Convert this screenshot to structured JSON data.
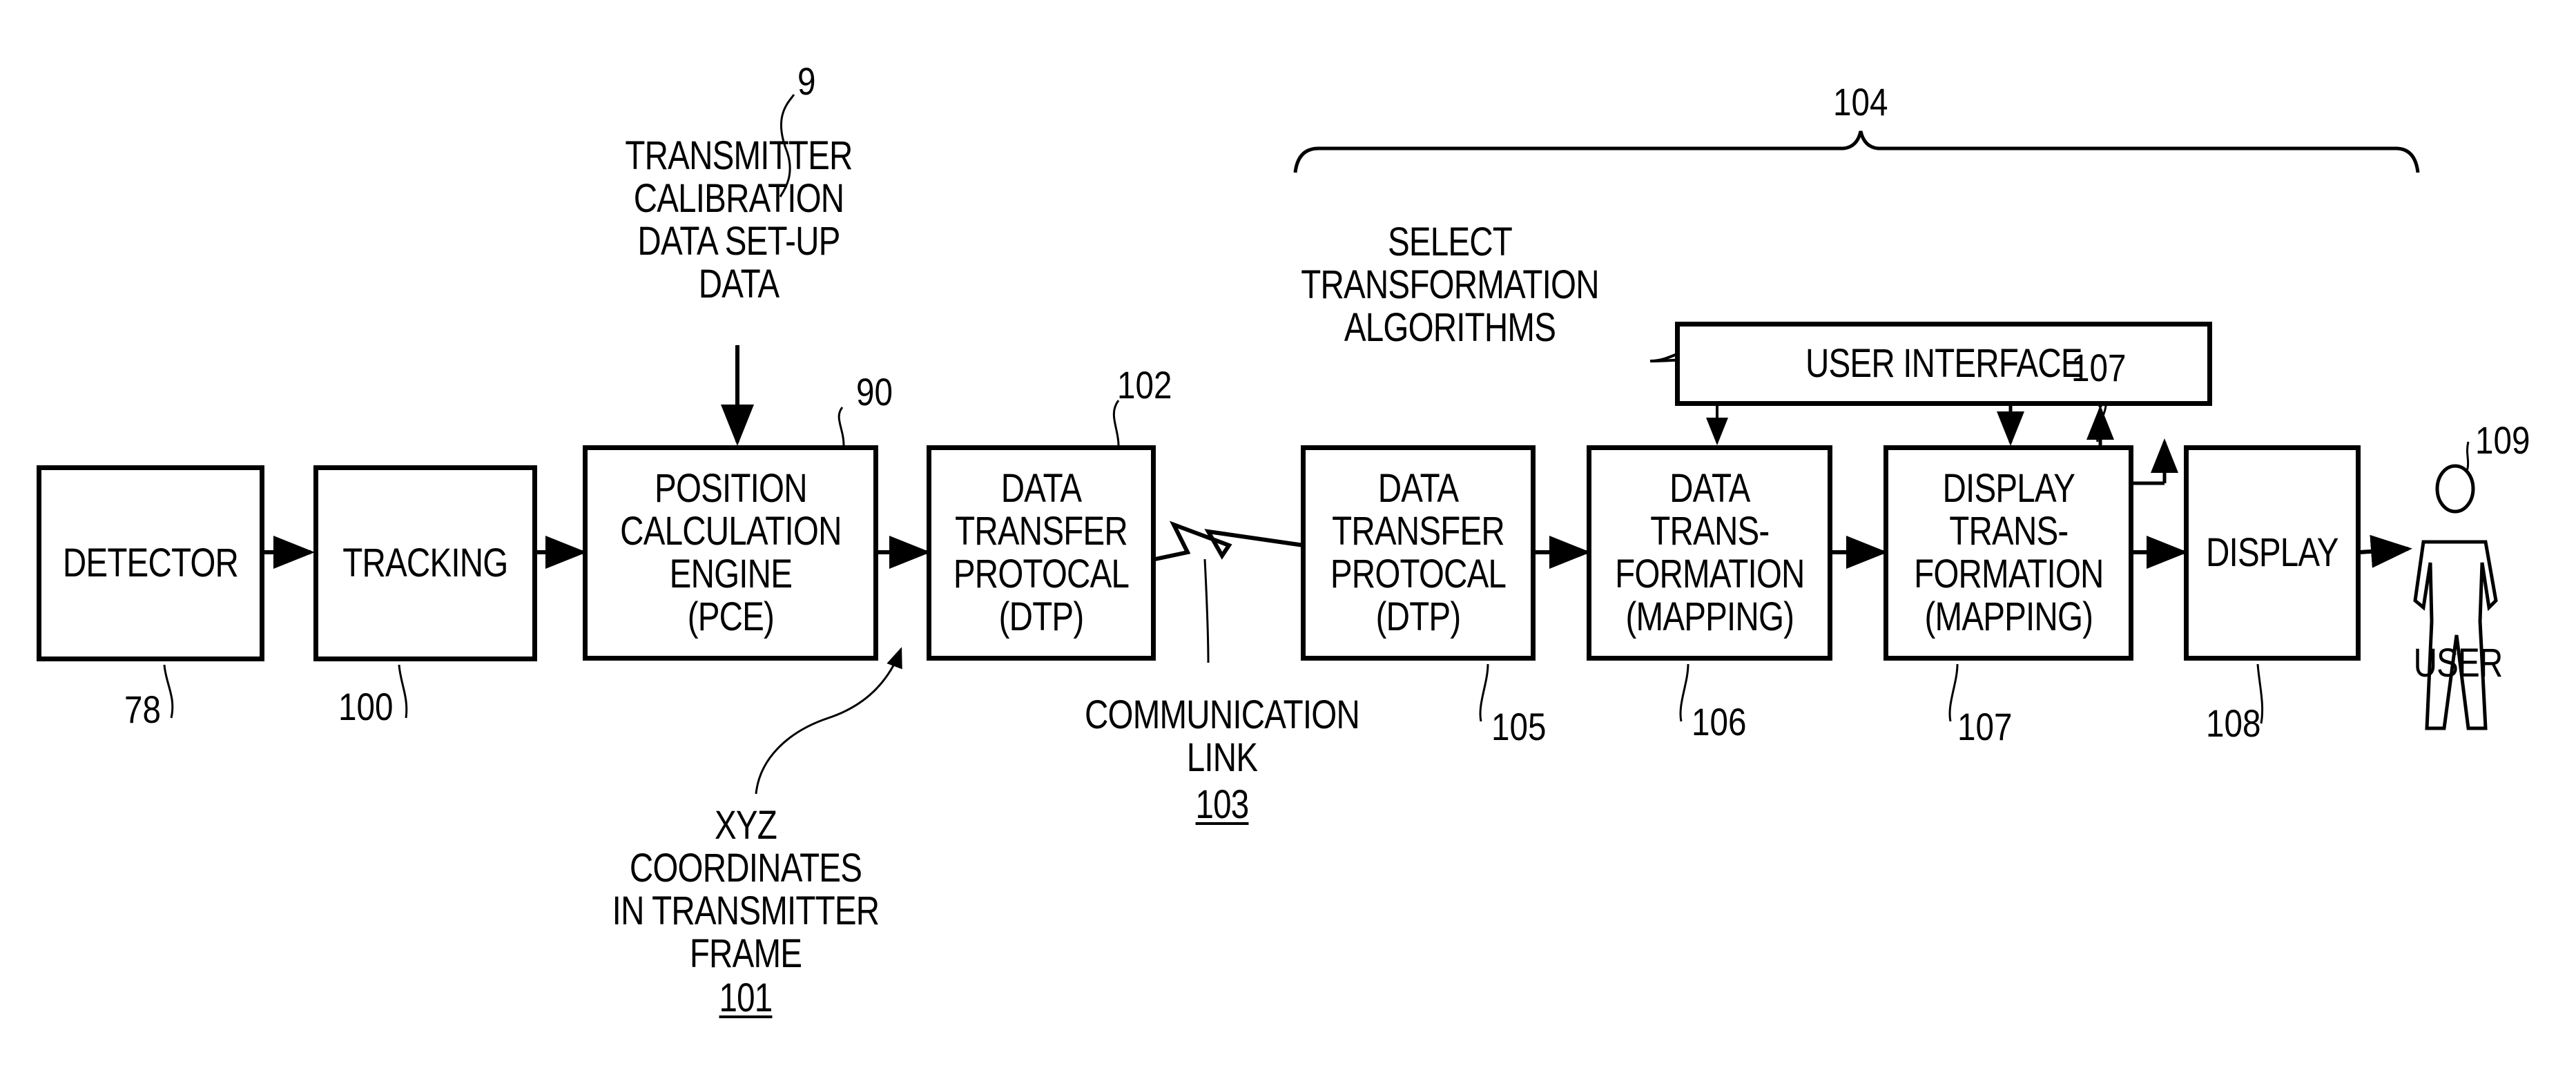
{
  "figure": {
    "blocks": [
      {
        "id": "detector",
        "label": "DETECTOR",
        "ref": "78"
      },
      {
        "id": "tracking",
        "label": "TRACKING",
        "ref": "100"
      },
      {
        "id": "pce",
        "label": "POSITION\nCALCULATION\nENGINE\n(PCE)",
        "ref": "90"
      },
      {
        "id": "dtp1",
        "label": "DATA\nTRANSFER\nPROTOCAL\n(DTP)",
        "ref": "102"
      },
      {
        "id": "dtp2",
        "label": "DATA\nTRANSFER\nPROTOCAL\n(DTP)",
        "ref": "105"
      },
      {
        "id": "data-transformation",
        "label": "DATA\nTRANS-\nFORMATION\n(MAPPING)",
        "ref": "106"
      },
      {
        "id": "display-transformation",
        "label": "DISPLAY\nTRANS-\nFORMATION\n(MAPPING)",
        "ref": "107"
      },
      {
        "id": "display",
        "label": "DISPLAY",
        "ref": "108"
      }
    ],
    "user_interface": {
      "label": "USER INTERFACE",
      "ref": "107"
    },
    "group_ref": "104",
    "user": {
      "label": "USER",
      "ref": "109"
    },
    "annotations": {
      "calibration": {
        "text": "TRANSMITTER\nCALIBRATION\nDATA SET-UP\nDATA",
        "ref": "9"
      },
      "xyz": {
        "text": "XYZ\nCOORDINATES\nIN TRANSMITTER\nFRAME",
        "ref": "101"
      },
      "comm_link": {
        "text": "COMMUNICATION\nLINK",
        "ref": "103"
      },
      "select": {
        "text": "SELECT\nTRANSFORMATION\nALGORITHMS"
      }
    }
  }
}
